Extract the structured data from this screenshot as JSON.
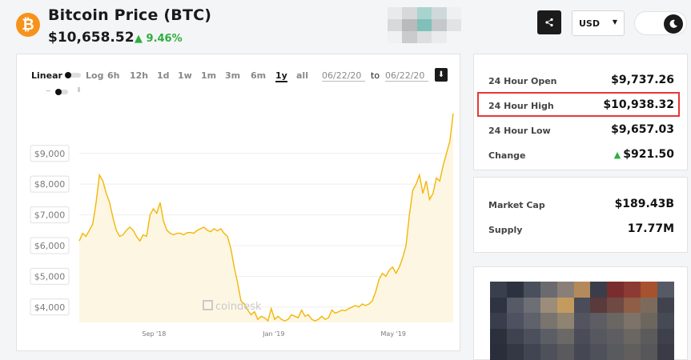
{
  "header": {
    "logo_glyph": "₿",
    "title": "Bitcoin Price (BTC)",
    "price": "$10,658.52",
    "change": "▲ 9.46%",
    "currency": "USD",
    "currency_caret": "▼"
  },
  "icons": {
    "share": "share-icon",
    "theme": "moon-icon",
    "download": "download-icon"
  },
  "controls": {
    "scale_label": "Linear",
    "log_label": "Log",
    "ranges": [
      "6h",
      "12h",
      "1d",
      "1w",
      "1m",
      "3m",
      "6m",
      "1y",
      "all"
    ],
    "active_range": "1y",
    "date_from": "06/22/20",
    "date_sep": "to",
    "date_to": "06/22/20"
  },
  "chart_data": {
    "type": "area",
    "ylabel": "",
    "xlabel": "",
    "yticks": [
      "$4,000",
      "$5,000",
      "$6,000",
      "$7,000",
      "$8,000",
      "$9,000"
    ],
    "ytick_values": [
      4000,
      5000,
      6000,
      7000,
      8000,
      9000
    ],
    "xticks": [
      "Sep '18",
      "Jan '19",
      "May '19"
    ],
    "xtick_positions": [
      0.2,
      0.52,
      0.84
    ],
    "ylim": [
      3500,
      10400
    ],
    "watermark": "coindesk",
    "color": "#f2b705",
    "fill": "#fdf6e3",
    "series": [
      {
        "values": [
          6150,
          6400,
          6300,
          6500,
          6700,
          7400,
          8300,
          8100,
          7700,
          7400,
          6900,
          6500,
          6300,
          6350,
          6500,
          6600,
          6500,
          6300,
          6150,
          6350,
          6300,
          7000,
          7200,
          7050,
          7400,
          6800,
          6500,
          6400,
          6350,
          6400,
          6400,
          6350,
          6420,
          6430,
          6400,
          6500,
          6550,
          6600,
          6500,
          6450,
          6550,
          6480,
          6550,
          6400,
          6300,
          5900,
          5300,
          4800,
          4200,
          4100,
          3900,
          3750,
          3850,
          3600,
          3700,
          3650,
          3550,
          3950,
          3600,
          3700,
          3600,
          3550,
          3600,
          3750,
          3700,
          3650,
          3900,
          3700,
          3750,
          3600,
          3550,
          3600,
          3700,
          3600,
          3650,
          3900,
          3800,
          3850,
          3900,
          3880,
          3950,
          4000,
          4050,
          4000,
          4100,
          4050,
          4100,
          4200,
          4500,
          4900,
          5100,
          5000,
          5200,
          5300,
          5100,
          5300,
          5600,
          6000,
          7000,
          7800,
          8000,
          8300,
          7700,
          8100,
          7500,
          7700,
          8200,
          8100,
          8600,
          9000,
          9400,
          10300
        ]
      }
    ]
  },
  "stats": {
    "open_label": "24 Hour Open",
    "open_value": "$9,737.26",
    "high_label": "24 Hour High",
    "high_value": "$10,938.32",
    "low_label": "24 Hour Low",
    "low_value": "$9,657.03",
    "change_label": "Change",
    "change_arrow": "▲",
    "change_value": "$921.50",
    "mcap_label": "Market Cap",
    "mcap_value": "$189.43B",
    "supply_label": "Supply",
    "supply_value": "17.77M"
  },
  "colors": {
    "accent": "#f7931a",
    "up": "#2fae3b",
    "highlight": "#e53935"
  }
}
